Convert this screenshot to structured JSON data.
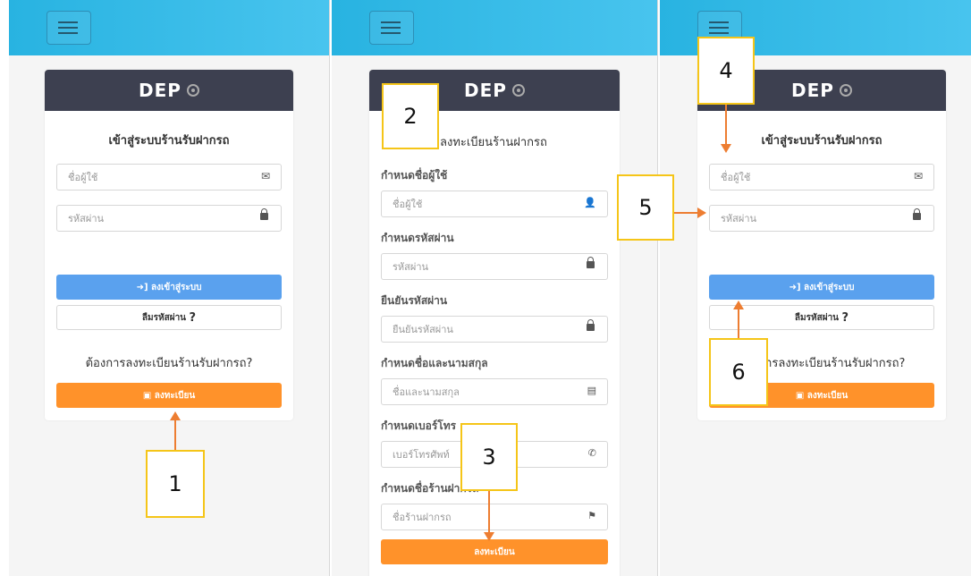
{
  "brand": "DEP",
  "login": {
    "title": "เข้าสู่ระบบร้านรับฝากรถ",
    "username_placeholder": "ชื่อผู้ใช้",
    "password_placeholder": "รหัสผ่าน",
    "login_button": "ลงเข้าสู่ระบบ",
    "forgot_button": "ลืมรหัสผ่าน",
    "forgot_icon": "?",
    "register_question": "ต้องการลงทะเบียนร้านรับฝากรถ?",
    "register_button": "ลงทะเบียน"
  },
  "register": {
    "title": "ลงทะเบียนร้านฝากรถ",
    "fields": [
      {
        "label": "กำหนดชื่อผู้ใช้",
        "placeholder": "ชื่อผู้ใช้",
        "icon": "user-icon"
      },
      {
        "label": "กำหนดรหัสผ่าน",
        "placeholder": "รหัสผ่าน",
        "icon": "lock-icon"
      },
      {
        "label": "ยืนยันรหัสผ่าน",
        "placeholder": "ยืนยันรหัสผ่าน",
        "icon": "lock-icon"
      },
      {
        "label": "กำหนดชื่อและนามสกุล",
        "placeholder": "ชื่อและนามสกุล",
        "icon": "id-card-icon"
      },
      {
        "label": "กำหนดเบอร์โทร",
        "placeholder": "เบอร์โทรศัพท์",
        "icon": "phone-icon"
      },
      {
        "label": "กำหนดชื่อร้านฝากรถ",
        "placeholder": "ชื่อร้านฝากรถ",
        "icon": "flag-icon"
      }
    ],
    "submit_button": "ลงทะเบียน"
  },
  "callouts": [
    "1",
    "2",
    "3",
    "4",
    "5",
    "6"
  ],
  "colors": {
    "topbar": "#28b3e1",
    "header": "#3d4050",
    "primary": "#5aa1ee",
    "accent": "#ff922a",
    "callout_border": "#f5c518",
    "arrow": "#ed7d31"
  }
}
